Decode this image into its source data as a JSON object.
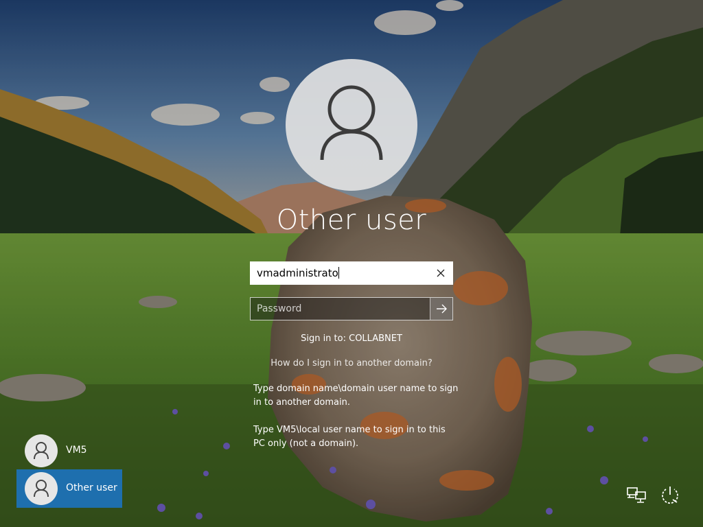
{
  "login": {
    "username_title": "Other user",
    "username_value": "vmadministrato",
    "password_placeholder": "Password",
    "sign_in_to": "Sign in to: COLLABNET",
    "help_link": "How do I sign in to another domain?",
    "help_text_1": "Type domain name\\domain user name to sign in to another domain.",
    "help_text_2": "Type VM5\\local user name to sign in to this PC only (not a domain)."
  },
  "users": [
    {
      "label": "VM5",
      "selected": false
    },
    {
      "label": "Other user",
      "selected": true
    }
  ],
  "icons": {
    "avatar": "user-icon",
    "clear": "close-icon",
    "submit": "arrow-right-icon",
    "network": "network-icon",
    "power": "power-icon"
  },
  "colors": {
    "selected_tile": "#1e6fae"
  }
}
